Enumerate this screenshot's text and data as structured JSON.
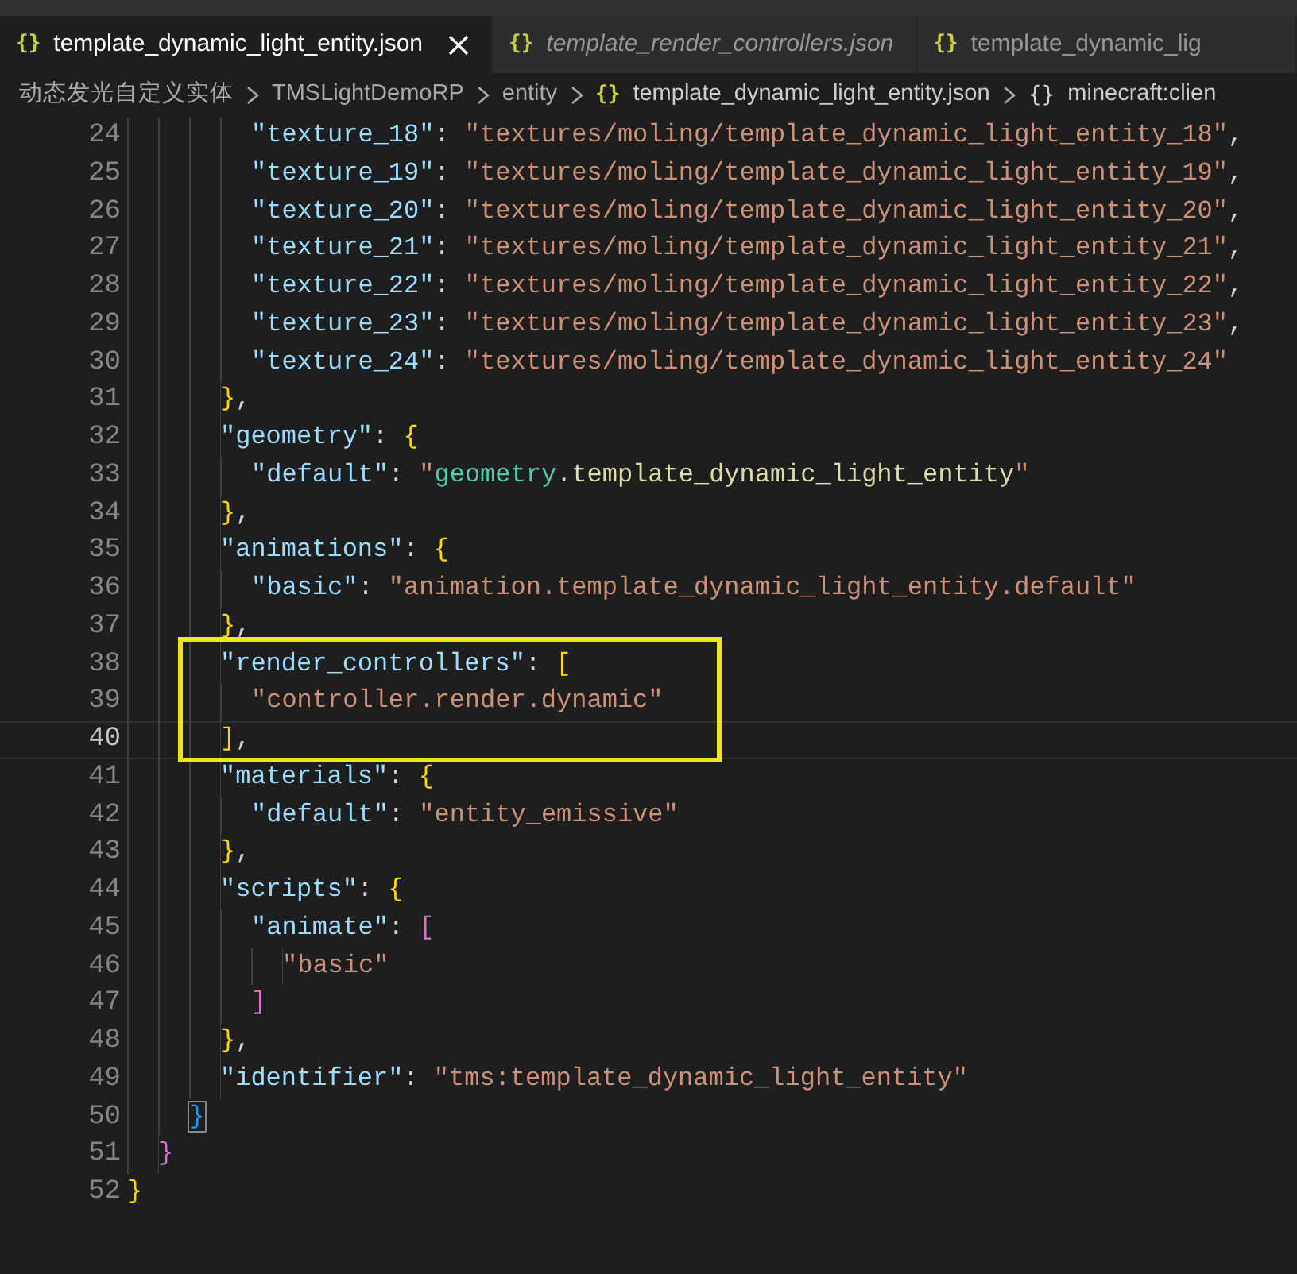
{
  "tabs": [
    {
      "icon": "{}",
      "label": "template_dynamic_light_entity.json",
      "selected": true,
      "preview": false
    },
    {
      "icon": "{}",
      "label": "template_render_controllers.json",
      "selected": false,
      "preview": true
    },
    {
      "icon": "{}",
      "label": "template_dynamic_lig",
      "selected": false,
      "preview": false
    }
  ],
  "breadcrumb": [
    {
      "kind": "folder",
      "label": "动态发光自定义实体"
    },
    {
      "kind": "folder",
      "label": "TMSLightDemoRP"
    },
    {
      "kind": "folder",
      "label": "entity"
    },
    {
      "kind": "file",
      "icon": "{}",
      "label": "template_dynamic_light_entity.json"
    },
    {
      "kind": "object",
      "icon": "{}",
      "label": "minecraft:clien"
    }
  ],
  "lines": [
    {
      "children": [
        {
          "children": [
            {
              "children": [
                {
                  "children": [
                    {
                      "number": "24",
                      "current": false,
                      "framed": false,
                      "tokens": [
                        {
                          "kind": "key",
                          "text": "\"texture_18\""
                        },
                        {
                          "kind": "punct",
                          "text": ": "
                        },
                        {
                          "kind": "string",
                          "text": "\"textures/moling/template_dynamic_light_entity_18\""
                        },
                        {
                          "kind": "punct",
                          "text": ","
                        }
                      ]
                    },
                    {
                      "number": "25",
                      "current": false,
                      "framed": false,
                      "tokens": [
                        {
                          "kind": "key",
                          "text": "\"texture_19\""
                        },
                        {
                          "kind": "punct",
                          "text": ": "
                        },
                        {
                          "kind": "string",
                          "text": "\"textures/moling/template_dynamic_light_entity_19\""
                        },
                        {
                          "kind": "punct",
                          "text": ","
                        }
                      ]
                    },
                    {
                      "number": "26",
                      "current": false,
                      "framed": false,
                      "tokens": [
                        {
                          "kind": "key",
                          "text": "\"texture_20\""
                        },
                        {
                          "kind": "punct",
                          "text": ": "
                        },
                        {
                          "kind": "string",
                          "text": "\"textures/moling/template_dynamic_light_entity_20\""
                        },
                        {
                          "kind": "punct",
                          "text": ","
                        }
                      ]
                    },
                    {
                      "number": "27",
                      "current": false,
                      "framed": false,
                      "tokens": [
                        {
                          "kind": "key",
                          "text": "\"texture_21\""
                        },
                        {
                          "kind": "punct",
                          "text": ": "
                        },
                        {
                          "kind": "string",
                          "text": "\"textures/moling/template_dynamic_light_entity_21\""
                        },
                        {
                          "kind": "punct",
                          "text": ","
                        }
                      ]
                    },
                    {
                      "number": "28",
                      "current": false,
                      "framed": false,
                      "tokens": [
                        {
                          "kind": "key",
                          "text": "\"texture_22\""
                        },
                        {
                          "kind": "punct",
                          "text": ": "
                        },
                        {
                          "kind": "string",
                          "text": "\"textures/moling/template_dynamic_light_entity_22\""
                        },
                        {
                          "kind": "punct",
                          "text": ","
                        }
                      ]
                    },
                    {
                      "number": "29",
                      "current": false,
                      "framed": false,
                      "tokens": [
                        {
                          "kind": "key",
                          "text": "\"texture_23\""
                        },
                        {
                          "kind": "punct",
                          "text": ": "
                        },
                        {
                          "kind": "string",
                          "text": "\"textures/moling/template_dynamic_light_entity_23\""
                        },
                        {
                          "kind": "punct",
                          "text": ","
                        }
                      ]
                    },
                    {
                      "number": "30",
                      "current": false,
                      "framed": false,
                      "tokens": [
                        {
                          "kind": "key",
                          "text": "\"texture_24\""
                        },
                        {
                          "kind": "punct",
                          "text": ": "
                        },
                        {
                          "kind": "string",
                          "text": "\"textures/moling/template_dynamic_light_entity_24\""
                        }
                      ]
                    }
                  ]
                },
                {
                  "number": "31",
                  "current": false,
                  "framed": false,
                  "tokens": [
                    {
                      "kind": "brace1",
                      "text": "}"
                    },
                    {
                      "kind": "punct",
                      "text": ","
                    }
                  ]
                },
                {
                  "number": "32",
                  "current": false,
                  "framed": false,
                  "tokens": [
                    {
                      "kind": "key",
                      "text": "\"geometry\""
                    },
                    {
                      "kind": "punct",
                      "text": ": "
                    },
                    {
                      "kind": "brace1",
                      "text": "{"
                    }
                  ]
                },
                {
                  "children": [
                    {
                      "number": "33",
                      "current": false,
                      "framed": false,
                      "tokens": [
                        {
                          "kind": "key",
                          "text": "\"default\""
                        },
                        {
                          "kind": "punct",
                          "text": ": "
                        },
                        {
                          "kind": "string",
                          "text": "\""
                        },
                        {
                          "kind": "type",
                          "text": "geometry"
                        },
                        {
                          "kind": "member",
                          "text": ".template_dynamic_light_entity"
                        },
                        {
                          "kind": "string",
                          "text": "\""
                        }
                      ]
                    }
                  ]
                },
                {
                  "number": "34",
                  "current": false,
                  "framed": false,
                  "tokens": [
                    {
                      "kind": "brace1",
                      "text": "}"
                    },
                    {
                      "kind": "punct",
                      "text": ","
                    }
                  ]
                },
                {
                  "number": "35",
                  "current": false,
                  "framed": false,
                  "tokens": [
                    {
                      "kind": "key",
                      "text": "\"animations\""
                    },
                    {
                      "kind": "punct",
                      "text": ": "
                    },
                    {
                      "kind": "brace1",
                      "text": "{"
                    }
                  ]
                },
                {
                  "children": [
                    {
                      "number": "36",
                      "current": false,
                      "framed": false,
                      "tokens": [
                        {
                          "kind": "key",
                          "text": "\"basic\""
                        },
                        {
                          "kind": "punct",
                          "text": ": "
                        },
                        {
                          "kind": "string",
                          "text": "\"animation.template_dynamic_light_entity.default\""
                        }
                      ]
                    }
                  ]
                },
                {
                  "number": "37",
                  "current": false,
                  "framed": false,
                  "tokens": [
                    {
                      "kind": "brace1",
                      "text": "}"
                    },
                    {
                      "kind": "punct",
                      "text": ","
                    }
                  ]
                },
                {
                  "number": "38",
                  "current": false,
                  "framed": true,
                  "tokens": [
                    {
                      "kind": "key",
                      "text": "\"render_controllers\""
                    },
                    {
                      "kind": "punct",
                      "text": ": "
                    },
                    {
                      "kind": "brace1",
                      "text": "["
                    }
                  ]
                },
                {
                  "children": [
                    {
                      "number": "39",
                      "current": false,
                      "framed": true,
                      "tokens": [
                        {
                          "kind": "string",
                          "text": "\"controller.render.dynamic\""
                        }
                      ]
                    }
                  ]
                },
                {
                  "number": "40",
                  "current": true,
                  "framed": true,
                  "tokens": [
                    {
                      "kind": "brace1",
                      "text": "]"
                    },
                    {
                      "kind": "punct",
                      "text": ","
                    }
                  ]
                },
                {
                  "number": "41",
                  "current": false,
                  "framed": false,
                  "tokens": [
                    {
                      "kind": "key",
                      "text": "\"materials\""
                    },
                    {
                      "kind": "punct",
                      "text": ": "
                    },
                    {
                      "kind": "brace1",
                      "text": "{"
                    }
                  ]
                },
                {
                  "children": [
                    {
                      "number": "42",
                      "current": false,
                      "framed": false,
                      "tokens": [
                        {
                          "kind": "key",
                          "text": "\"default\""
                        },
                        {
                          "kind": "punct",
                          "text": ": "
                        },
                        {
                          "kind": "string",
                          "text": "\"entity_emissive\""
                        }
                      ]
                    }
                  ]
                },
                {
                  "number": "43",
                  "current": false,
                  "framed": false,
                  "tokens": [
                    {
                      "kind": "brace1",
                      "text": "}"
                    },
                    {
                      "kind": "punct",
                      "text": ","
                    }
                  ]
                },
                {
                  "number": "44",
                  "current": false,
                  "framed": false,
                  "tokens": [
                    {
                      "kind": "key",
                      "text": "\"scripts\""
                    },
                    {
                      "kind": "punct",
                      "text": ": "
                    },
                    {
                      "kind": "brace1",
                      "text": "{"
                    }
                  ]
                },
                {
                  "children": [
                    {
                      "number": "45",
                      "current": false,
                      "framed": false,
                      "tokens": [
                        {
                          "kind": "key",
                          "text": "\"animate\""
                        },
                        {
                          "kind": "punct",
                          "text": ": "
                        },
                        {
                          "kind": "brace2",
                          "text": "["
                        }
                      ]
                    },
                    {
                      "children": [
                        {
                          "number": "46",
                          "current": false,
                          "framed": false,
                          "tokens": [
                            {
                              "kind": "string",
                              "text": "\"basic\""
                            }
                          ]
                        }
                      ]
                    },
                    {
                      "number": "47",
                      "current": false,
                      "framed": false,
                      "tokens": [
                        {
                          "kind": "brace2",
                          "text": "]"
                        }
                      ]
                    }
                  ]
                },
                {
                  "number": "48",
                  "current": false,
                  "framed": false,
                  "tokens": [
                    {
                      "kind": "brace1",
                      "text": "}"
                    },
                    {
                      "kind": "punct",
                      "text": ","
                    }
                  ]
                },
                {
                  "number": "49",
                  "current": false,
                  "framed": false,
                  "tokens": [
                    {
                      "kind": "key",
                      "text": "\"identifier\""
                    },
                    {
                      "kind": "punct",
                      "text": ": "
                    },
                    {
                      "kind": "string",
                      "text": "\"tms:template_dynamic_light_entity\""
                    }
                  ]
                }
              ]
            },
            {
              "number": "50",
              "current": false,
              "framed": false,
              "tokens": [
                {
                  "kind": "brace3",
                  "text": "}"
                }
              ]
            }
          ]
        },
        {
          "number": "51",
          "current": false,
          "framed": false,
          "tokens": [
            {
              "kind": "brace2",
              "text": "}"
            }
          ]
        }
      ]
    },
    {
      "number": "52",
      "current": false,
      "framed": false,
      "tokens": [
        {
          "kind": "brace1",
          "text": "}"
        }
      ]
    }
  ]
}
